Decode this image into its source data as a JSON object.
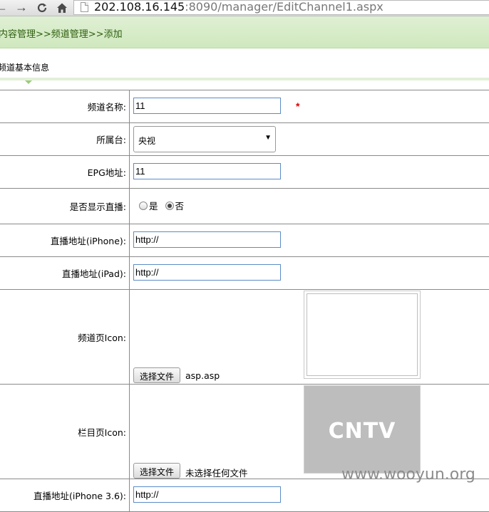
{
  "browser": {
    "back_icon": "back-arrow-icon",
    "forward_icon": "forward-arrow-icon",
    "reload_icon": "reload-icon",
    "home_icon": "home-icon",
    "url_host": "202.108.16.145",
    "url_rest": ":8090/manager/EditChannel1.aspx"
  },
  "breadcrumb": "内容管理>>频道管理>>添加",
  "section_title": "频道基本信息",
  "form": {
    "channel_name": {
      "label": "频道名称:",
      "value": "11",
      "required": "*"
    },
    "station": {
      "label": "所属台:",
      "selected": "央视"
    },
    "epg": {
      "label": "EPG地址:",
      "value": "11"
    },
    "show_live": {
      "label": "是否显示直播:",
      "option_yes": "是",
      "option_no": "否",
      "selected": "否"
    },
    "live_iphone": {
      "label": "直播地址(iPhone):",
      "value": "http://"
    },
    "live_ipad": {
      "label": "直播地址(iPad):",
      "value": "http://"
    },
    "channel_icon": {
      "label": "频道页Icon:",
      "button": "选择文件",
      "file": "asp.asp"
    },
    "column_icon": {
      "label": "栏目页Icon:",
      "button": "选择文件",
      "file": "未选择任何文件",
      "logo_text": "CNTV"
    },
    "live_iphone36": {
      "label": "直播地址(iPhone 3.6):",
      "value": "http://"
    }
  },
  "watermark": "www.wooyun.org"
}
